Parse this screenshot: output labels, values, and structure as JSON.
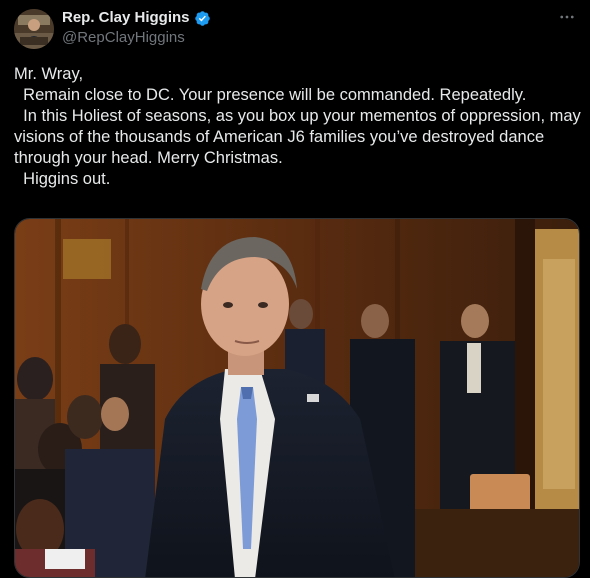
{
  "author": {
    "display_name": "Rep. Clay Higgins",
    "handle": "@RepClayHiggins",
    "verified": true,
    "avatar_icon": "user-avatar-photo"
  },
  "more_icon": "more-options-icon",
  "tweet": {
    "lines": [
      "Mr. Wray,",
      "  Remain close to DC. Your presence will be commanded. Repeatedly.",
      "  In this Holiest of seasons, as you box up your mementos of oppression, may visions of the thousands of American J6 families you’ve destroyed dance through your head. Merry Christmas.",
      "  Higgins out."
    ]
  },
  "media": {
    "type": "photo",
    "description_icon": "tweet-photo"
  },
  "colors": {
    "background": "#000000",
    "text": "#e7e9ea",
    "secondary": "#71767b",
    "verified": "#1d9bf0"
  }
}
